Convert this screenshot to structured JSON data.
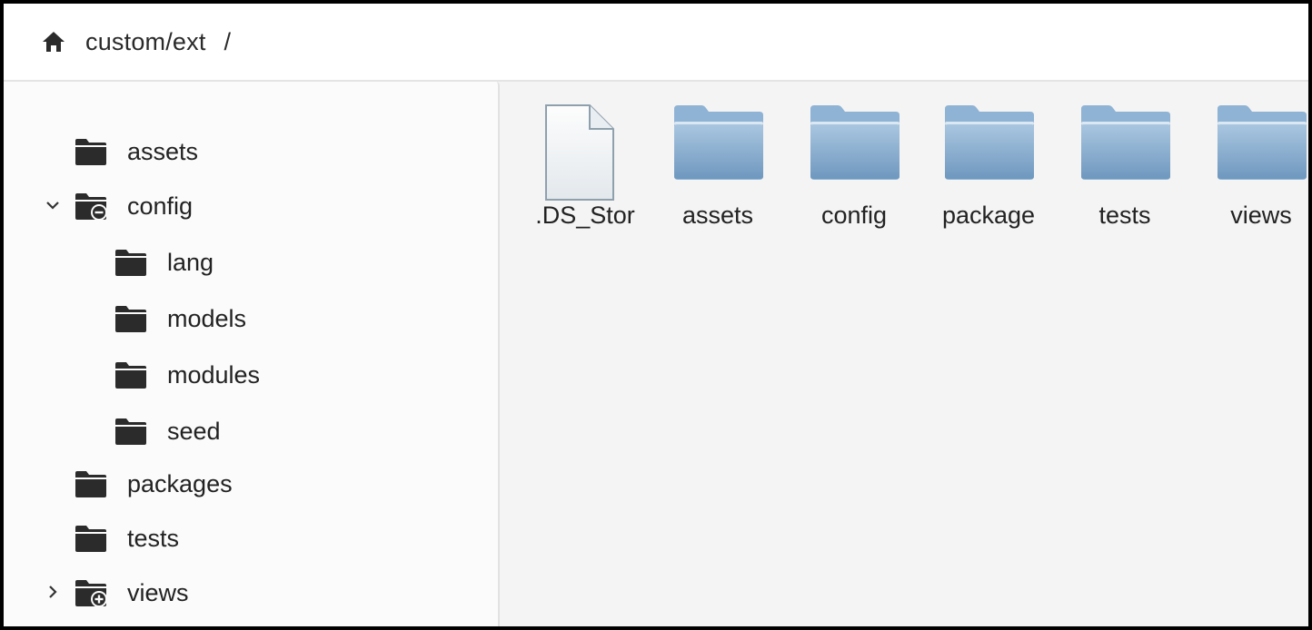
{
  "breadcrumb": {
    "home_icon": "home-icon",
    "path": "custom/ext",
    "separator": "/"
  },
  "sidebar": {
    "items": [
      {
        "label": "assets",
        "icon": "folder-icon",
        "expander": "none"
      },
      {
        "label": "config",
        "icon": "folder-minus-icon",
        "expander": "chevron-down-icon"
      },
      {
        "label": "lang",
        "icon": "folder-icon",
        "expander": "none"
      },
      {
        "label": "models",
        "icon": "folder-icon",
        "expander": "none"
      },
      {
        "label": "modules",
        "icon": "folder-icon",
        "expander": "none"
      },
      {
        "label": "seed",
        "icon": "folder-icon",
        "expander": "none"
      },
      {
        "label": "packages",
        "icon": "folder-icon",
        "expander": "none"
      },
      {
        "label": "tests",
        "icon": "folder-icon",
        "expander": "none"
      },
      {
        "label": "views",
        "icon": "folder-plus-icon",
        "expander": "chevron-right-icon"
      }
    ]
  },
  "main": {
    "items": [
      {
        "name": ".DS_Stor",
        "type": "file",
        "icon": "document-icon"
      },
      {
        "name": "assets",
        "type": "folder",
        "icon": "folder-icon"
      },
      {
        "name": "config",
        "type": "folder",
        "icon": "folder-icon"
      },
      {
        "name": "package",
        "type": "folder",
        "icon": "folder-icon"
      },
      {
        "name": "tests",
        "type": "folder",
        "icon": "folder-icon"
      },
      {
        "name": "views",
        "type": "folder",
        "icon": "folder-icon"
      }
    ]
  },
  "colors": {
    "tree_icon": "#2b2b2b",
    "folder_blue": "#7fa6c9",
    "sidebar_bg": "#fbfbfb",
    "main_bg": "#f4f4f4"
  }
}
